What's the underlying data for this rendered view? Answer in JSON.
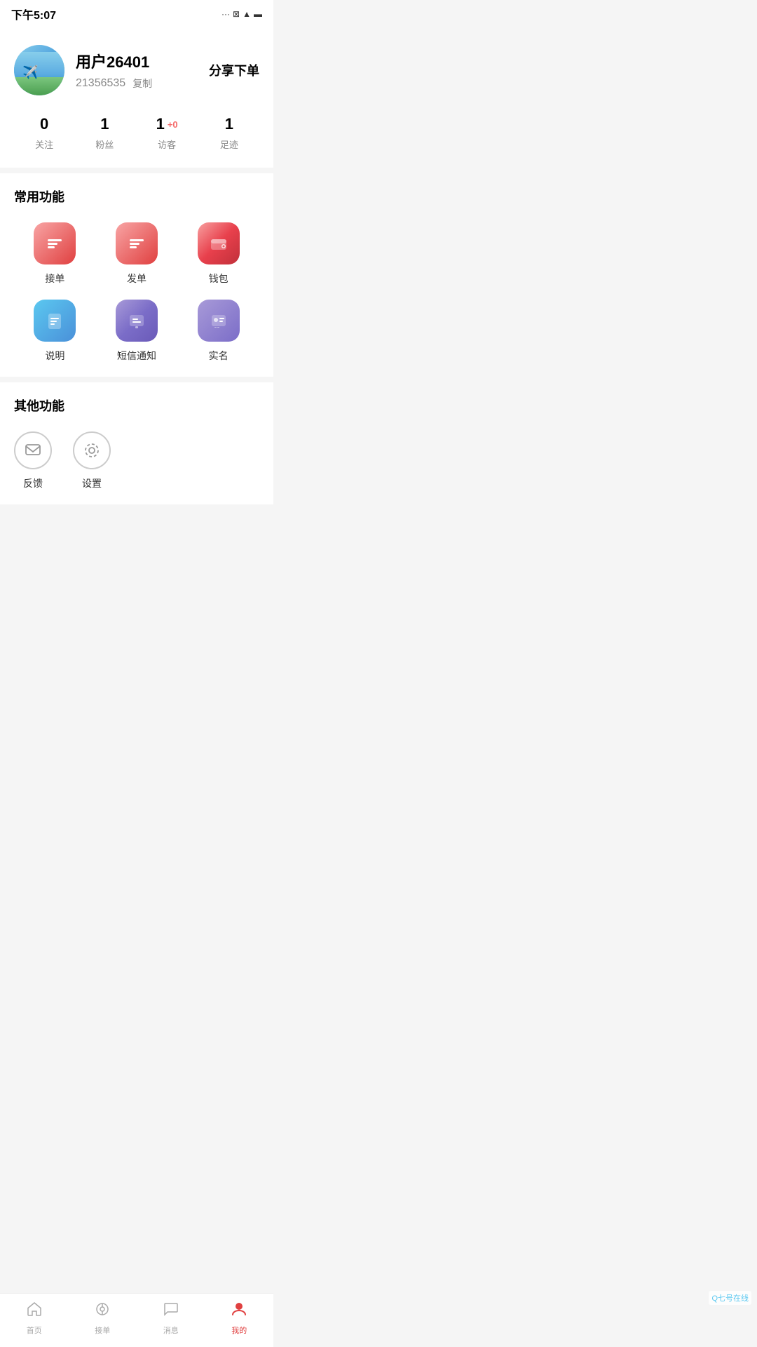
{
  "statusBar": {
    "time": "下午5:07"
  },
  "profile": {
    "name": "用户26401",
    "id": "21356535",
    "copyLabel": "复制",
    "shareLabel": "分享下单"
  },
  "stats": [
    {
      "number": "0",
      "badge": "",
      "label": "关注"
    },
    {
      "number": "1",
      "badge": "",
      "label": "粉丝"
    },
    {
      "number": "1",
      "badge": "+0",
      "label": "访客"
    },
    {
      "number": "1",
      "badge": "",
      "label": "足迹"
    }
  ],
  "commonFunctions": {
    "title": "常用功能",
    "items": [
      {
        "id": "jiedan",
        "label": "接单",
        "iconClass": "icon-jiedan"
      },
      {
        "id": "fadan",
        "label": "发单",
        "iconClass": "icon-fadan"
      },
      {
        "id": "qianbao",
        "label": "钱包",
        "iconClass": "icon-qianbao"
      },
      {
        "id": "shuoming",
        "label": "说明",
        "iconClass": "icon-shuoming"
      },
      {
        "id": "sms",
        "label": "短信通知",
        "iconClass": "icon-sms"
      },
      {
        "id": "shiming",
        "label": "实名",
        "iconClass": "icon-shiming"
      }
    ]
  },
  "otherFunctions": {
    "title": "其他功能",
    "items": [
      {
        "id": "feedback",
        "label": "反馈"
      },
      {
        "id": "settings",
        "label": "设置"
      }
    ]
  },
  "bottomNav": {
    "items": [
      {
        "id": "home",
        "label": "首页",
        "active": false
      },
      {
        "id": "jiedan",
        "label": "接单",
        "active": false
      },
      {
        "id": "message",
        "label": "消息",
        "active": false
      },
      {
        "id": "mine",
        "label": "我的",
        "active": true
      }
    ]
  },
  "watermark": "Q七号在线"
}
